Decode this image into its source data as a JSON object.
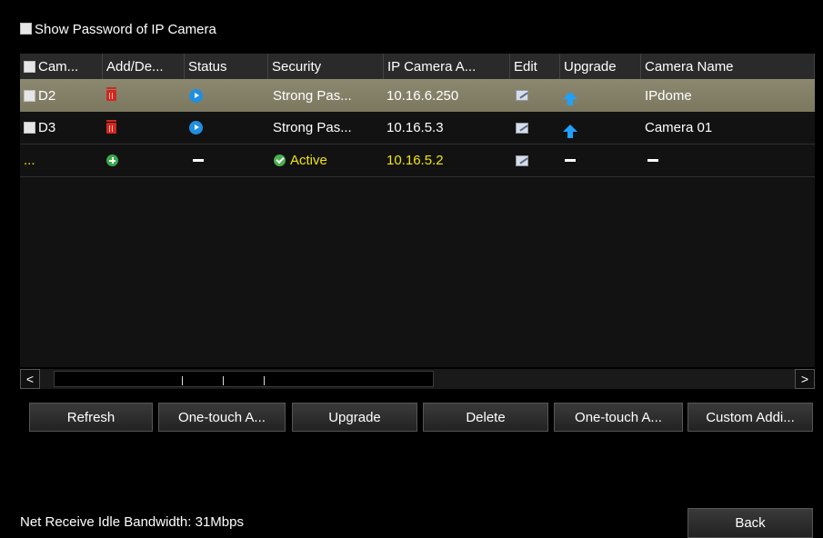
{
  "show_password": {
    "label": "Show Password of IP Camera",
    "checked": false
  },
  "table": {
    "columns": [
      "Cam...",
      "Add/De...",
      "Status",
      "Security",
      "IP Camera A...",
      "Edit",
      "Upgrade",
      "Camera Name"
    ],
    "rows": [
      {
        "camera": "D2",
        "add_delete": "trash-icon",
        "status": "play-icon",
        "security": "Strong Pas...",
        "ip": "10.16.6.250",
        "edit": "edit-icon",
        "upgrade": "upgrade-arrow-icon",
        "name": "IPdome",
        "selected": true
      },
      {
        "camera": "D3",
        "add_delete": "trash-icon",
        "status": "play-icon",
        "security": "Strong Pas...",
        "ip": "10.16.5.3",
        "edit": "edit-icon",
        "upgrade": "upgrade-arrow-icon",
        "name": "Camera 01",
        "selected": false
      },
      {
        "camera": "...",
        "add_delete": "add-icon",
        "status": "dash",
        "security": "Active",
        "security_icon": "check-circle-icon",
        "ip": "10.16.5.2",
        "edit": "edit-icon",
        "upgrade": "dash",
        "name": "dash",
        "selected": false
      }
    ]
  },
  "scrollbar": {
    "left_arrow": "<",
    "right_arrow": ">"
  },
  "buttons": {
    "refresh": "Refresh",
    "one_touch_1": "One-touch A...",
    "upgrade": "Upgrade",
    "delete": "Delete",
    "one_touch_2": "One-touch A...",
    "custom_add": "Custom Addi...",
    "back": "Back"
  },
  "status_bar": {
    "bandwidth": "Net Receive Idle Bandwidth: 31Mbps"
  },
  "colors": {
    "background": "#000000",
    "selected_row": "#85816a",
    "highlight_text": "#f2e600",
    "delete_icon": "#d0281f",
    "status_icon": "#1f8fe0"
  }
}
